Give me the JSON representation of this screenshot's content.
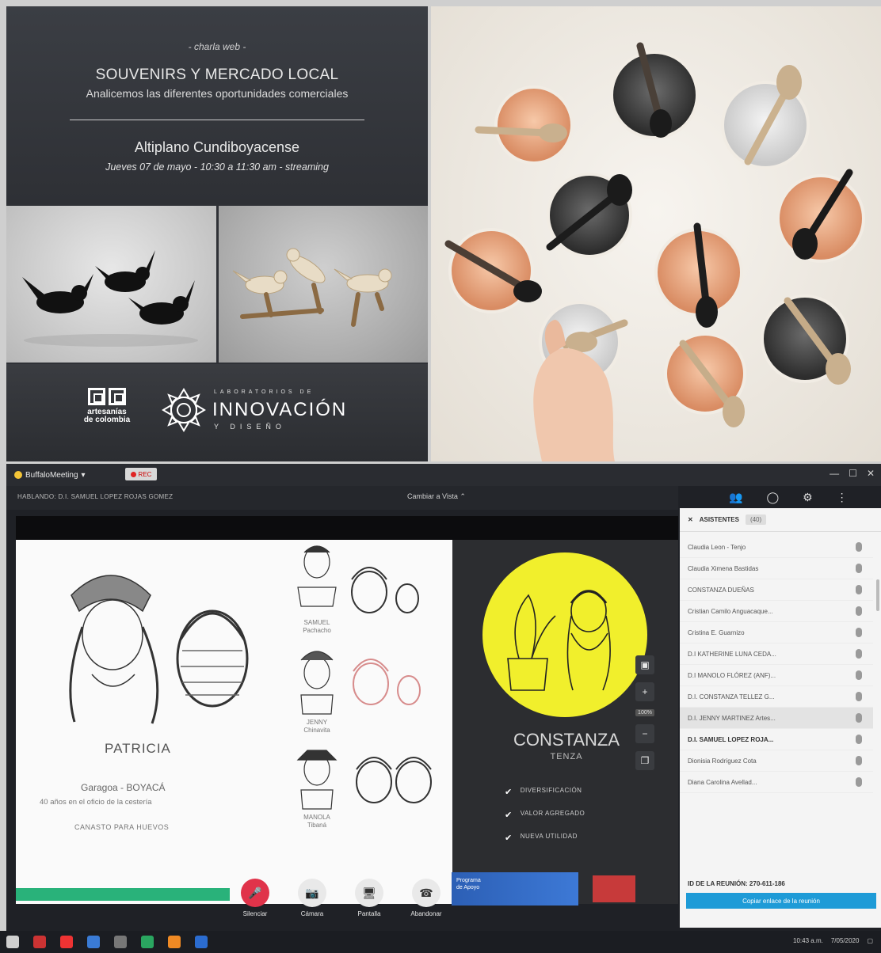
{
  "poster": {
    "kicker": "- charla web -",
    "title": "SOUVENIRS Y MERCADO LOCAL",
    "subtitle": "Analicemos las diferentes oportunidades comerciales",
    "region": "Altiplano Cundiboyacense",
    "date": "Jueves 07 de mayo  -  10:30 a 11:30 am  -  streaming",
    "logo_artesanias": "artesanías\nde colombia",
    "logo_lab_top": "LABORATORIOS DE",
    "logo_lab_main": "INNOVACIÓN",
    "logo_lab_bottom": "Y DISEÑO"
  },
  "meeting": {
    "app_name": "BuffaloMeeting",
    "rec_label": "REC",
    "host_label": "HABLANDO: D.I. SAMUEL LOPEZ ROJAS GOMEZ",
    "layout_label": "Cambiar a Vista  ⌃",
    "slide": {
      "patricia_name": "PATRICIA",
      "patricia_loc": "Garagoa - BOYACÁ",
      "patricia_years": "40 años en el oficio de la cestería",
      "patricia_product": "CANASTO PARA HUEVOS",
      "samuel_caption": "SAMUEL\nPachacho",
      "jenny_caption": "JENNY\nChinavita",
      "manola_caption": "MANOLA\nTibaná",
      "constanza_name": "CONSTANZA",
      "constanza_loc": "TENZA",
      "checks": [
        "DIVERSIFICACIÓN",
        "VALOR AGREGADO",
        "NUEVA UTILIDAD"
      ]
    },
    "zoom_label": "100%",
    "banner_blue_text": "Programa\nde Apoyo",
    "toolbar": [
      {
        "label": "Silenciar",
        "icon": "🎤"
      },
      {
        "label": "Cámara",
        "icon": "📷"
      },
      {
        "label": "Pantalla",
        "icon": "🖥"
      },
      {
        "label": "Abandonar",
        "icon": "☎"
      }
    ],
    "panel": {
      "title": "ASISTENTES",
      "count": "(40)",
      "participants": [
        "Claudia Leon - Tenjo",
        "Claudia Ximena Bastidas",
        "CONSTANZA DUEÑAS",
        "Cristian Camilo Anguacaque...",
        "Cristina E. Guarnizo",
        "D.I KATHERINE LUNA CEDA...",
        "D.I MANOLO FLÓREZ (ANF)...",
        "D.I. CONSTANZA TELLEZ G...",
        "D.I. JENNY MARTINEZ Artes...",
        "D.I. SAMUEL LOPEZ ROJA...",
        "Dionisia Rodríguez Cota",
        "Diana Carolina Avellad..."
      ],
      "meeting_id": "ID DE LA REUNIÓN:  270-611-186",
      "join_label": "Copiar enlace de la reunión"
    },
    "taskbar_time": "10:43 a.m.",
    "taskbar_date": "7/05/2020"
  },
  "colors": {
    "accent_yellow": "#f1ef2c",
    "mute_red": "#e0334a",
    "join_blue": "#1e9bd7",
    "banner_green": "#29b27a"
  }
}
